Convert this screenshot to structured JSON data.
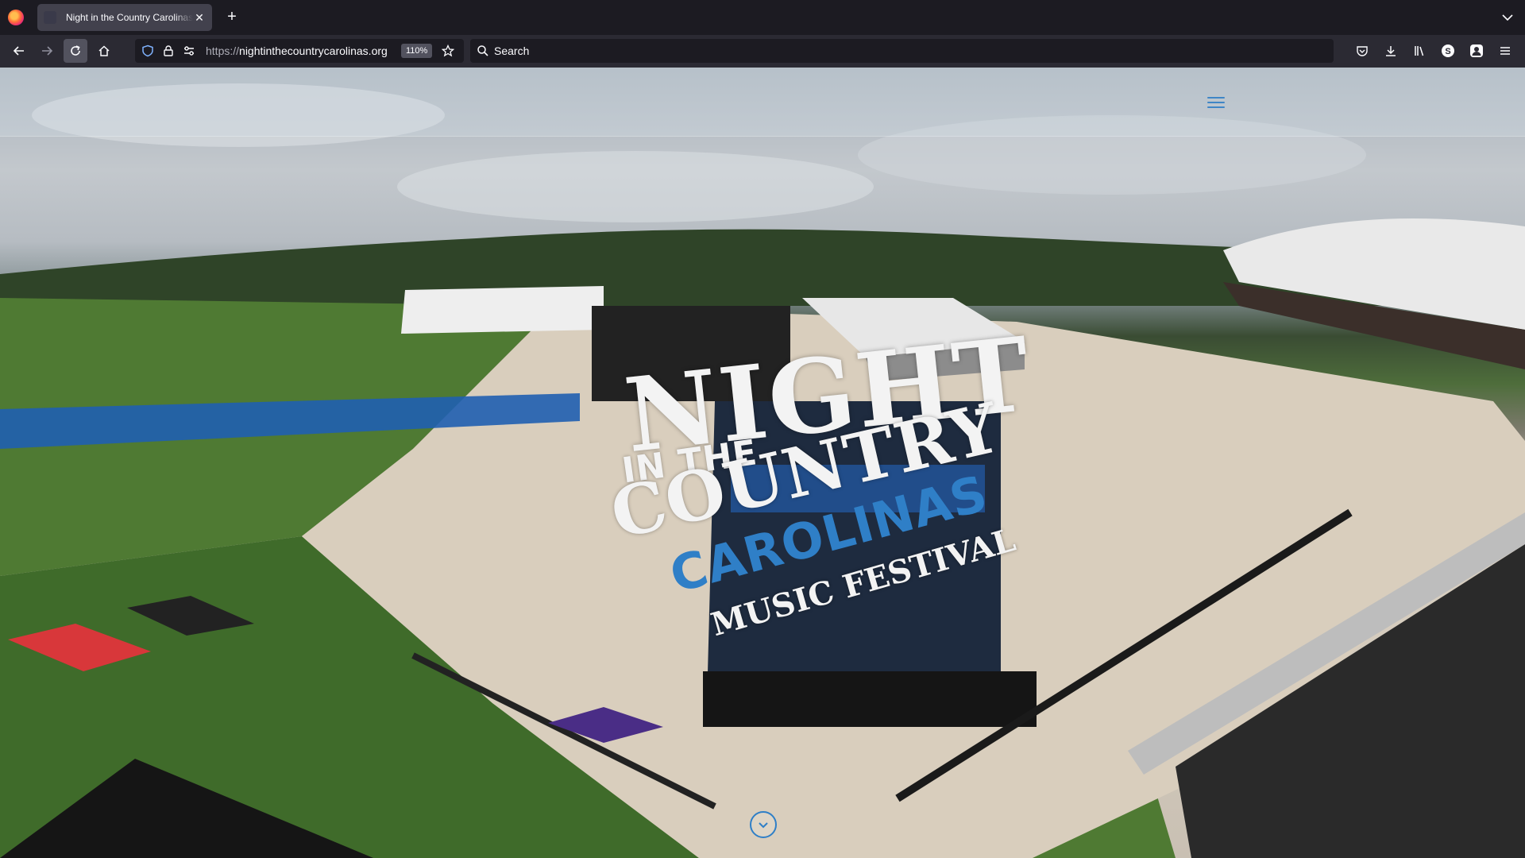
{
  "browser": {
    "tab": {
      "title": "Night in the Country Carolinas | Music Festival",
      "close_glyph": "✕"
    },
    "new_tab_glyph": "+",
    "url": {
      "protocol": "https://",
      "host": "nightinthecountrycarolinas.org"
    },
    "zoom_label": "110%",
    "search_placeholder": "Search"
  },
  "site": {
    "logo": {
      "line1": "NIGHT",
      "line2": "IN THE",
      "line3": "COUNTRY",
      "line4": "CAROLINAS",
      "line5": "MUSIC FESTIVAL"
    },
    "colors": {
      "accent": "#2f7fc7",
      "logo_white": "#f3f3f3"
    }
  }
}
